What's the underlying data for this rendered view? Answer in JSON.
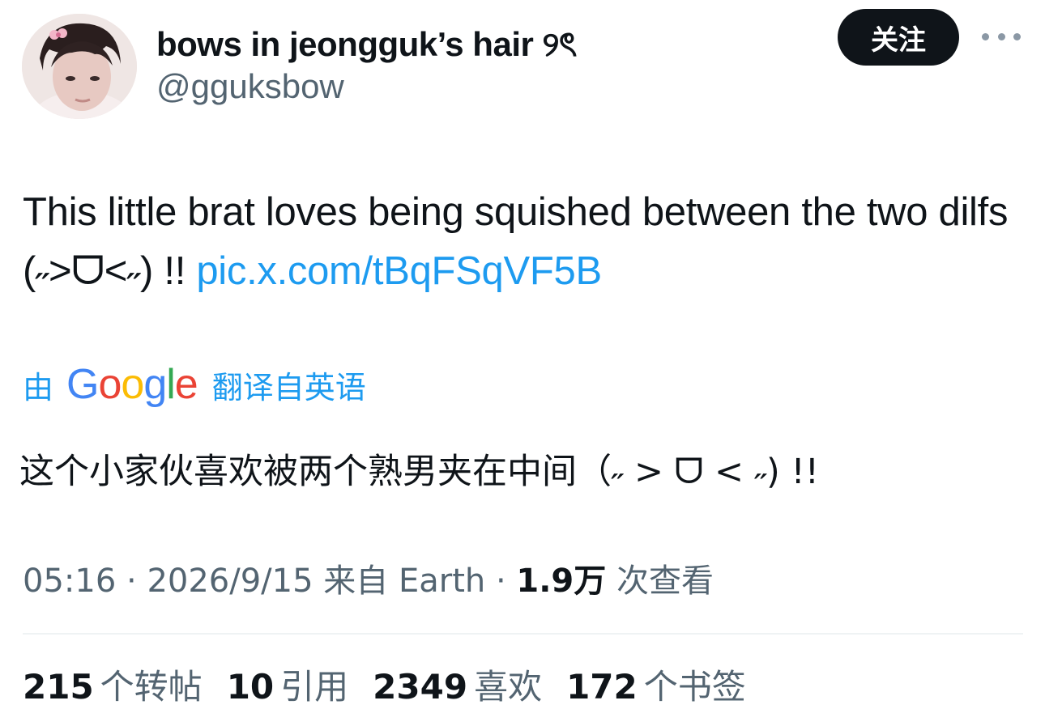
{
  "user": {
    "display_name": "bows in jeongguk’s hair ୨ৎ",
    "handle": "@gguksbow",
    "follow_label": "关注"
  },
  "tweet": {
    "text": "This little brat loves being squished between the two dilfs (˶˃ᗜ˂˶) !! ",
    "link": "pic.x.com/tBqFSqVF5B"
  },
  "translation": {
    "prefix": "由",
    "provider": "Google",
    "suffix": "翻译自英语",
    "text": "这个小家伙喜欢被两个熟男夹在中间（˶ > ᗜ < ˶) !!"
  },
  "meta": {
    "time": "05:16",
    "date": "2026/9/15",
    "source": "来自 Earth",
    "views_count": "1.9万",
    "views_label": "次查看"
  },
  "stats": {
    "retweets_count": "215",
    "retweets_label": "个转帖",
    "quotes_count": "10",
    "quotes_label": "引用",
    "likes_count": "2349",
    "likes_label": "喜欢",
    "bookmarks_count": "172",
    "bookmarks_label": "个书签"
  },
  "colors": {
    "link": "#1d9bf0",
    "secondary_text": "#536471",
    "primary_text": "#0f1419",
    "follow_bg": "#0f1419"
  },
  "icons": {
    "more": "more-horizontal-icon"
  }
}
